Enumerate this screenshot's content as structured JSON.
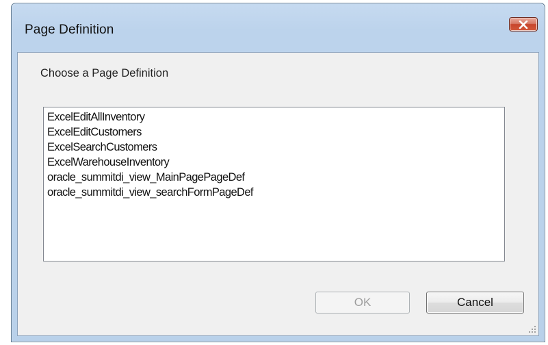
{
  "window": {
    "title": "Page Definition"
  },
  "dialog": {
    "prompt": "Choose a Page Definition",
    "items": [
      "ExcelEditAllInventory",
      "ExcelEditCustomers",
      "ExcelSearchCustomers",
      "ExcelWarehouseInventory",
      "oracle_summitdi_view_MainPagePageDef",
      "oracle_summitdi_view_searchFormPageDef"
    ],
    "ok_label": "OK",
    "ok_enabled": false,
    "cancel_label": "Cancel"
  },
  "icons": {
    "close": "close-x-icon",
    "grip": "size-grip-icon"
  },
  "colors": {
    "frame": "#b9d1ea",
    "close_button": "#c7452c",
    "client": "#f0f0f0",
    "disabled_text": "#9d9d9d"
  }
}
